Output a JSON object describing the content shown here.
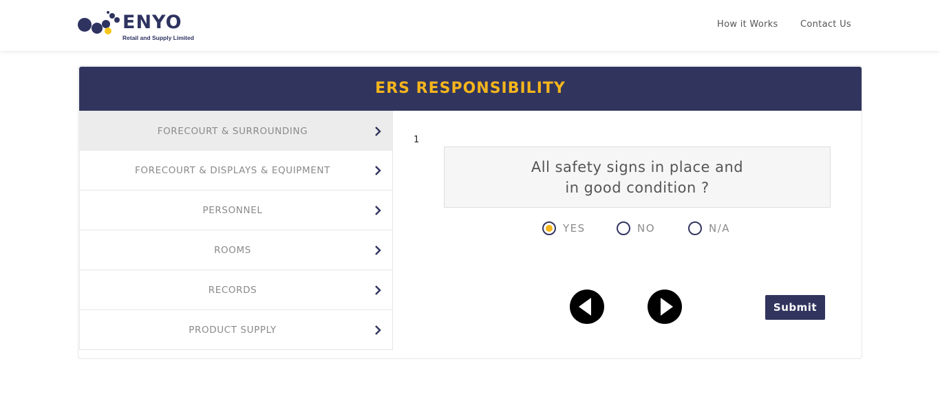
{
  "header": {
    "logo_text": "ENYO",
    "logo_subtitle": "Retail and Supply Limited",
    "nav": [
      "How it Works",
      "Contact Us"
    ]
  },
  "page": {
    "title": "ERS RESPONSIBILITY"
  },
  "sidebar": {
    "items": [
      {
        "label": "FORECOURT & SURROUNDING",
        "active": true
      },
      {
        "label": "FORECOURT & DISPLAYS & EQUIPMENT",
        "active": false
      },
      {
        "label": "PERSONNEL",
        "active": false
      },
      {
        "label": "ROOMS",
        "active": false
      },
      {
        "label": "RECORDS",
        "active": false
      },
      {
        "label": "PRODUCT SUPPLY",
        "active": false
      }
    ]
  },
  "question": {
    "number": "1",
    "text": "All safety signs in place and in good condition ?",
    "options": [
      {
        "label": "YES",
        "selected": true
      },
      {
        "label": "NO",
        "selected": false
      },
      {
        "label": "N/A",
        "selected": false
      }
    ]
  },
  "actions": {
    "submit_label": "Submit"
  },
  "colors": {
    "brand_navy": "#31355e",
    "accent_yellow": "#f5b51c"
  },
  "icons": [
    "chevron-right-icon",
    "arrow-left-circle-icon",
    "arrow-right-circle-icon",
    "radio-icon"
  ]
}
